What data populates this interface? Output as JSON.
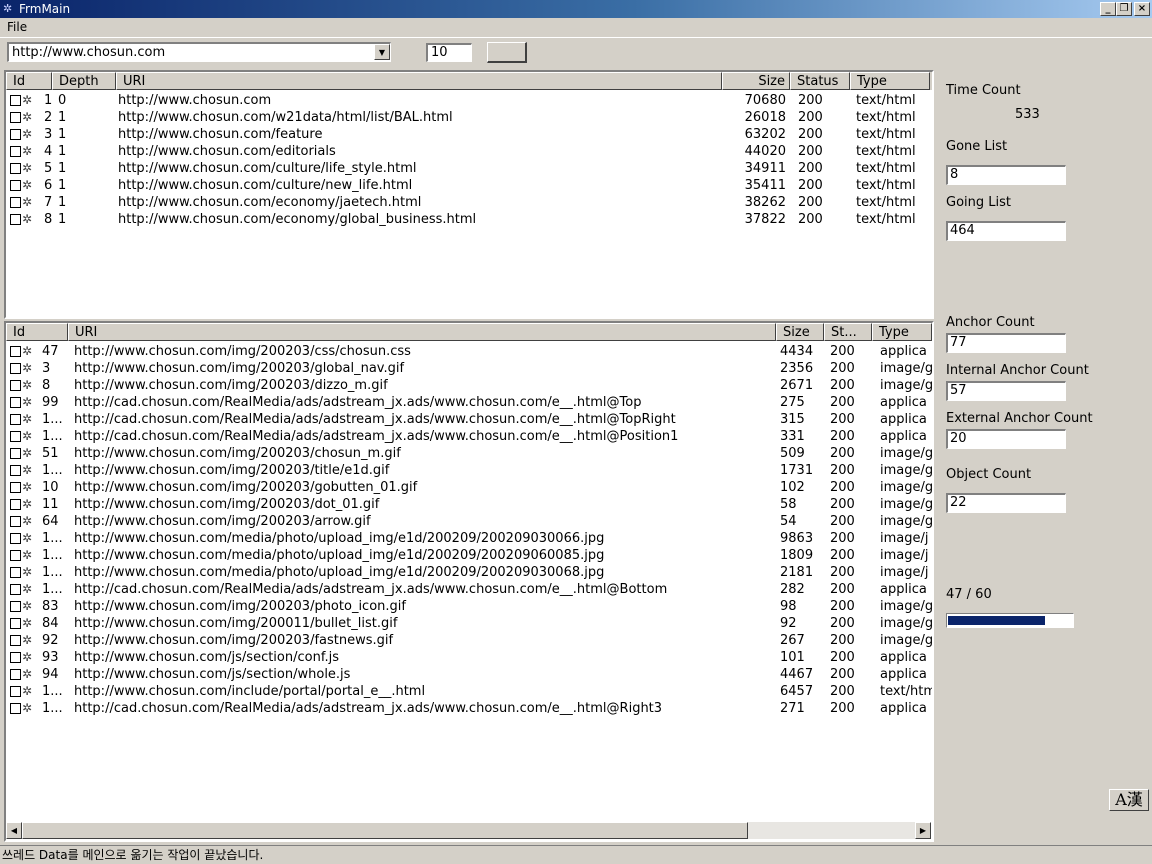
{
  "window": {
    "title": "FrmMain"
  },
  "menu": {
    "file_label": "File"
  },
  "toolbar": {
    "url_value": "http://www.chosun.com",
    "depth_value": "10",
    "go_label": ""
  },
  "top_list": {
    "columns": [
      "Id",
      "Depth",
      "URI",
      "Size",
      "Status",
      "Type"
    ],
    "rows": [
      {
        "id": "1",
        "depth": "0",
        "uri": "http://www.chosun.com",
        "size": "70680",
        "status": "200",
        "type": "text/html"
      },
      {
        "id": "2",
        "depth": "1",
        "uri": "http://www.chosun.com/w21data/html/list/BAL.html",
        "size": "26018",
        "status": "200",
        "type": "text/html"
      },
      {
        "id": "3",
        "depth": "1",
        "uri": "http://www.chosun.com/feature",
        "size": "63202",
        "status": "200",
        "type": "text/html"
      },
      {
        "id": "4",
        "depth": "1",
        "uri": "http://www.chosun.com/editorials",
        "size": "44020",
        "status": "200",
        "type": "text/html"
      },
      {
        "id": "5",
        "depth": "1",
        "uri": "http://www.chosun.com/culture/life_style.html",
        "size": "34911",
        "status": "200",
        "type": "text/html"
      },
      {
        "id": "6",
        "depth": "1",
        "uri": "http://www.chosun.com/culture/new_life.html",
        "size": "35411",
        "status": "200",
        "type": "text/html"
      },
      {
        "id": "7",
        "depth": "1",
        "uri": "http://www.chosun.com/economy/jaetech.html",
        "size": "38262",
        "status": "200",
        "type": "text/html"
      },
      {
        "id": "8",
        "depth": "1",
        "uri": "http://www.chosun.com/economy/global_business.html",
        "size": "37822",
        "status": "200",
        "type": "text/html"
      }
    ]
  },
  "bottom_list": {
    "columns": [
      "Id",
      "URI",
      "Size",
      "St...",
      "Type"
    ],
    "rows": [
      {
        "id": "47",
        "uri": "http://www.chosun.com/img/200203/css/chosun.css",
        "size": "4434",
        "status": "200",
        "type": "applica"
      },
      {
        "id": "3",
        "uri": "http://www.chosun.com/img/200203/global_nav.gif",
        "size": "2356",
        "status": "200",
        "type": "image/g"
      },
      {
        "id": "8",
        "uri": "http://www.chosun.com/img/200203/dizzo_m.gif",
        "size": "2671",
        "status": "200",
        "type": "image/g"
      },
      {
        "id": "99",
        "uri": "http://cad.chosun.com/RealMedia/ads/adstream_jx.ads/www.chosun.com/e__.html@Top",
        "size": "275",
        "status": "200",
        "type": "applica"
      },
      {
        "id": "1...",
        "uri": "http://cad.chosun.com/RealMedia/ads/adstream_jx.ads/www.chosun.com/e__.html@TopRight",
        "size": "315",
        "status": "200",
        "type": "applica"
      },
      {
        "id": "1...",
        "uri": "http://cad.chosun.com/RealMedia/ads/adstream_jx.ads/www.chosun.com/e__.html@Position1",
        "size": "331",
        "status": "200",
        "type": "applica"
      },
      {
        "id": "51",
        "uri": "http://www.chosun.com/img/200203/chosun_m.gif",
        "size": "509",
        "status": "200",
        "type": "image/g"
      },
      {
        "id": "1...",
        "uri": "http://www.chosun.com/img/200203/title/e1d.gif",
        "size": "1731",
        "status": "200",
        "type": "image/g"
      },
      {
        "id": "10",
        "uri": "http://www.chosun.com/img/200203/gobutten_01.gif",
        "size": "102",
        "status": "200",
        "type": "image/g"
      },
      {
        "id": "11",
        "uri": "http://www.chosun.com/img/200203/dot_01.gif",
        "size": "58",
        "status": "200",
        "type": "image/g"
      },
      {
        "id": "64",
        "uri": "http://www.chosun.com/img/200203/arrow.gif",
        "size": "54",
        "status": "200",
        "type": "image/g"
      },
      {
        "id": "1...",
        "uri": "http://www.chosun.com/media/photo/upload_img/e1d/200209/200209030066.jpg",
        "size": "9863",
        "status": "200",
        "type": "image/j"
      },
      {
        "id": "1...",
        "uri": "http://www.chosun.com/media/photo/upload_img/e1d/200209/200209060085.jpg",
        "size": "1809",
        "status": "200",
        "type": "image/j"
      },
      {
        "id": "1...",
        "uri": "http://www.chosun.com/media/photo/upload_img/e1d/200209/200209030068.jpg",
        "size": "2181",
        "status": "200",
        "type": "image/j"
      },
      {
        "id": "1...",
        "uri": "http://cad.chosun.com/RealMedia/ads/adstream_jx.ads/www.chosun.com/e__.html@Bottom",
        "size": "282",
        "status": "200",
        "type": "applica"
      },
      {
        "id": "83",
        "uri": "http://www.chosun.com/img/200203/photo_icon.gif",
        "size": "98",
        "status": "200",
        "type": "image/g"
      },
      {
        "id": "84",
        "uri": "http://www.chosun.com/img/200011/bullet_list.gif",
        "size": "92",
        "status": "200",
        "type": "image/g"
      },
      {
        "id": "92",
        "uri": "http://www.chosun.com/img/200203/fastnews.gif",
        "size": "267",
        "status": "200",
        "type": "image/g"
      },
      {
        "id": "93",
        "uri": "http://www.chosun.com/js/section/conf.js",
        "size": "101",
        "status": "200",
        "type": "applica"
      },
      {
        "id": "94",
        "uri": "http://www.chosun.com/js/section/whole.js",
        "size": "4467",
        "status": "200",
        "type": "applica"
      },
      {
        "id": "1...",
        "uri": "http://www.chosun.com/include/portal/portal_e__.html",
        "size": "6457",
        "status": "200",
        "type": "text/htm"
      },
      {
        "id": "1...",
        "uri": "http://cad.chosun.com/RealMedia/ads/adstream_jx.ads/www.chosun.com/e__.html@Right3",
        "size": "271",
        "status": "200",
        "type": "applica"
      }
    ]
  },
  "stats": {
    "time_count_label": "Time Count",
    "time_count_value": "533",
    "gone_list_label": "Gone List",
    "gone_list_value": "8",
    "going_list_label": "Going List",
    "going_list_value": "464",
    "anchor_count_label": "Anchor Count",
    "anchor_count_value": "77",
    "internal_anchor_label": "Internal Anchor Count",
    "internal_anchor_value": "57",
    "external_anchor_label": "External Anchor Count",
    "external_anchor_value": "20",
    "object_count_label": "Object Count",
    "object_count_value": "22",
    "progress_text": "47 / 60",
    "progress_fraction": 0.78
  },
  "ime": {
    "label": "A漢"
  },
  "status": {
    "text": "쓰레드 Data를 메인으로 옮기는 작업이 끝났습니다."
  },
  "colors": {
    "title_start": "#0a246a",
    "title_end": "#a6caf0",
    "progress": "#0a246a",
    "face": "#d4d0c8"
  }
}
